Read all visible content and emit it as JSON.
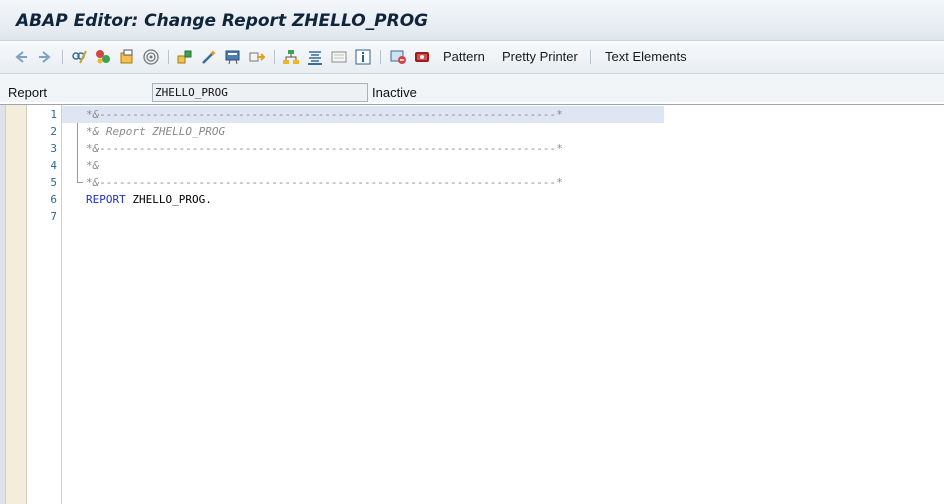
{
  "window": {
    "title": "ABAP Editor: Change Report ZHELLO_PROG"
  },
  "toolbar": {
    "icons": [
      "back-arrow-icon",
      "forward-arrow-icon",
      "display-change-icon",
      "activate-icon",
      "check-icon",
      "target-icon",
      "other-object-icon",
      "wand-icon",
      "display-object-list-icon",
      "where-used-icon",
      "hierarchy-icon",
      "navigation-window-icon",
      "fullscreen-icon",
      "info-icon",
      "help-icon",
      "debug-icon"
    ],
    "pattern_label": "Pattern",
    "pretty_printer_label": "Pretty Printer",
    "text_elements_label": "Text Elements"
  },
  "field": {
    "label": "Report",
    "value": "ZHELLO_PROG",
    "status": "Inactive"
  },
  "editor": {
    "lines": [
      {
        "num": "1",
        "text": "*&---------------------------------------------------------------------*",
        "type": "comment"
      },
      {
        "num": "2",
        "text": "*& Report ZHELLO_PROG",
        "type": "comment"
      },
      {
        "num": "3",
        "text": "*&---------------------------------------------------------------------*",
        "type": "comment"
      },
      {
        "num": "4",
        "text": "*&",
        "type": "comment"
      },
      {
        "num": "5",
        "text": "*&---------------------------------------------------------------------*",
        "type": "comment"
      },
      {
        "num": "6",
        "keyword": "REPORT",
        "rest": " ZHELLO_PROG.",
        "type": "code"
      },
      {
        "num": "7",
        "text": "",
        "type": "empty"
      }
    ]
  },
  "colors": {
    "keyword": "#1f2fd0",
    "comment": "#8a8a8a",
    "line_number": "#2a6a9c",
    "highlight": "#dde6f2"
  }
}
